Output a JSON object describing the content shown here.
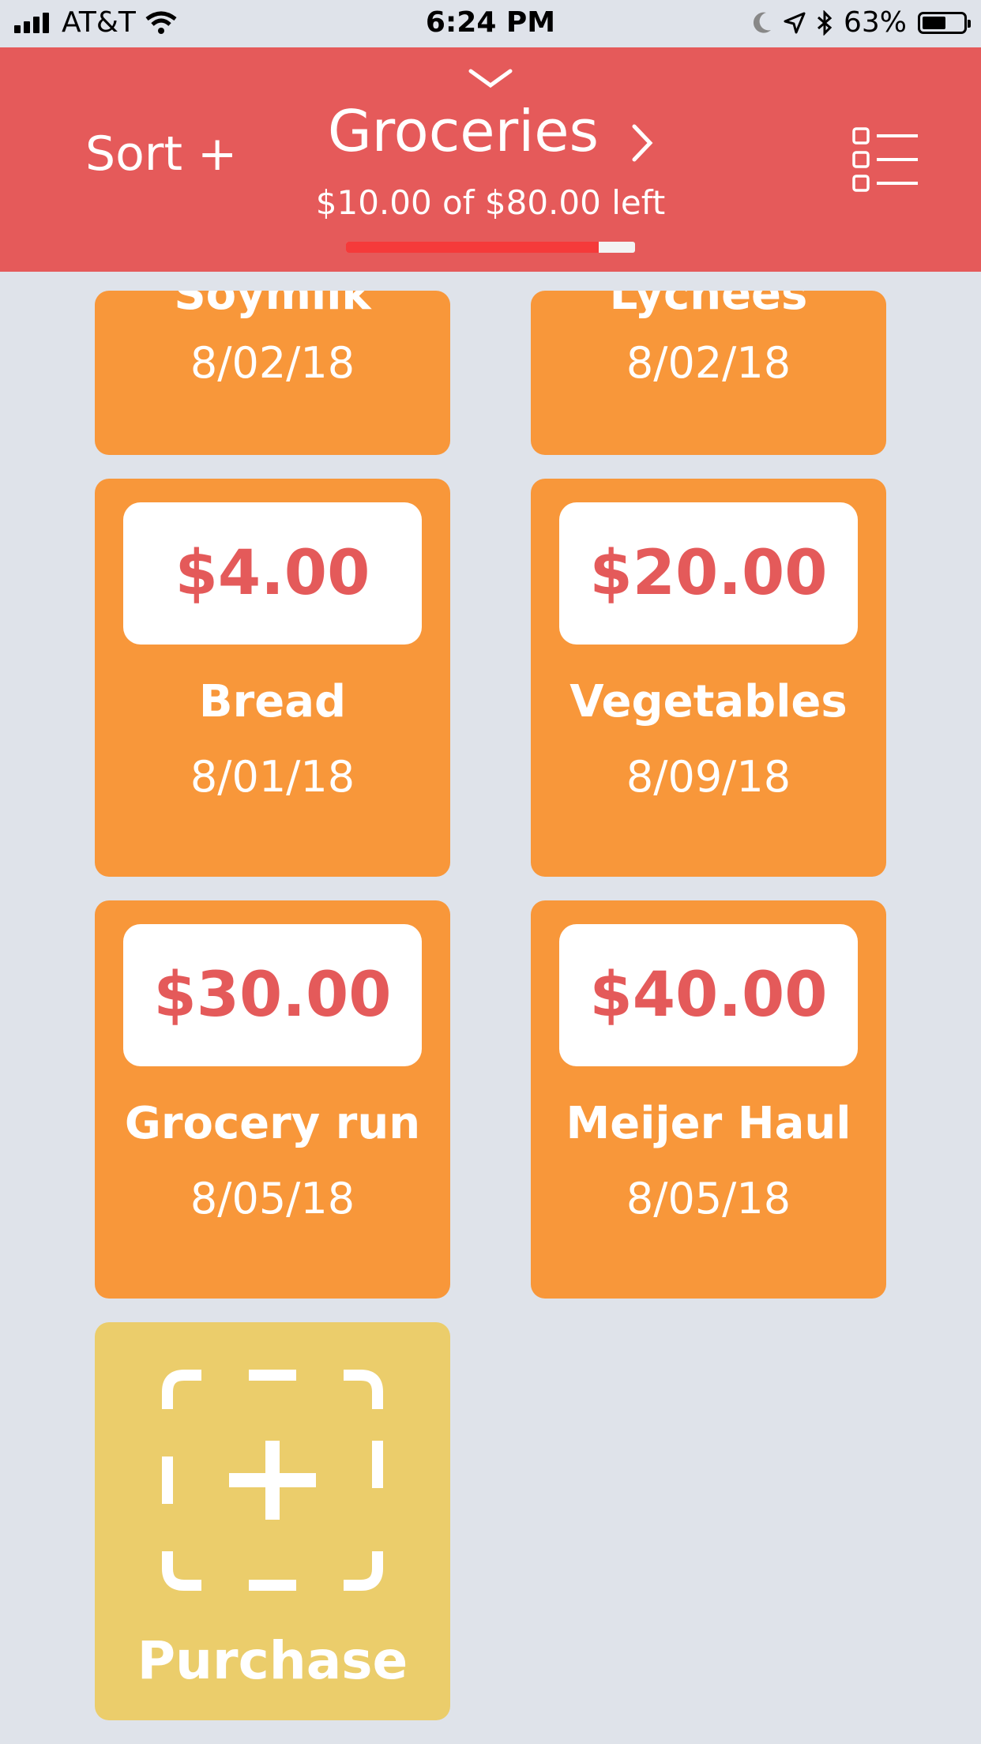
{
  "status_bar": {
    "carrier": "AT&T",
    "time": "6:24 PM",
    "battery": "63%",
    "battery_level": 0.63
  },
  "header": {
    "sort_label": "Sort +",
    "title": "Groceries",
    "subtitle": "$10.00 of $80.00 left",
    "budget_spent_fraction": 0.875,
    "accent_color": "#e55a5a"
  },
  "items": [
    {
      "name": "Soymilk",
      "date": "8/02/18"
    },
    {
      "name": "Lychees",
      "date": "8/02/18"
    },
    {
      "price": "$4.00",
      "name": "Bread",
      "date": "8/01/18"
    },
    {
      "price": "$20.00",
      "name": "Vegetables",
      "date": "8/09/18"
    },
    {
      "price": "$30.00",
      "name": "Grocery run",
      "date": "8/05/18"
    },
    {
      "price": "$40.00",
      "name": "Meijer Haul",
      "date": "8/05/18"
    }
  ],
  "purchase": {
    "label": "Purchase"
  },
  "colors": {
    "card": "#f8973a",
    "price_text": "#e45a5a",
    "purchase_card": "#ebcd6b",
    "background": "#dfe3ea"
  },
  "icons": [
    "signal-icon",
    "wifi-icon",
    "moon-icon",
    "location-icon",
    "bluetooth-icon",
    "battery-icon",
    "chevron-down-icon",
    "chevron-right-icon",
    "list-icon",
    "add-purchase-icon"
  ]
}
